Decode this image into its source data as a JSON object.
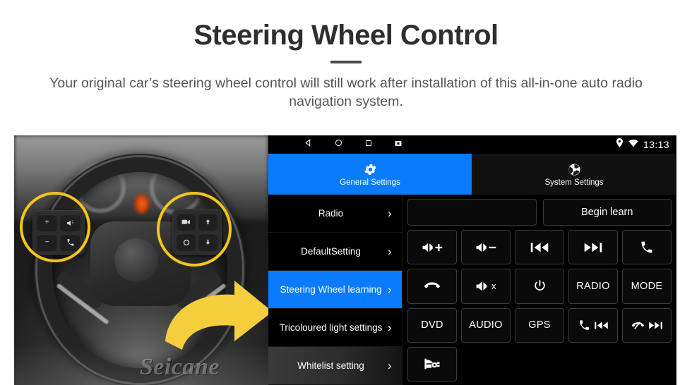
{
  "header": {
    "title": "Steering Wheel Control",
    "subtitle": "Your original car’s steering wheel control will still work after installation of this all-in-one auto radio navigation system."
  },
  "colors": {
    "accent_blue": "#0b7bfd",
    "highlight_yellow": "#f5c518",
    "screen_black": "#000000",
    "title_gray": "#2e2e2e"
  },
  "photo": {
    "watermark": "Seicane",
    "left_pad_keys": [
      "volume-up",
      "voice-command",
      "volume-down",
      "call"
    ],
    "right_pad_keys": [
      "media-source",
      "up-arrow",
      "circle-mode",
      "down-arrow"
    ],
    "highlight_circles": 2,
    "arrow": "right-arrow"
  },
  "statusbar": {
    "icons": [
      "back-icon",
      "home-icon",
      "recents-icon",
      "screenshot-icon"
    ],
    "location_icon": "location-icon",
    "wifi_icon": "wifi-icon",
    "time": "13:13"
  },
  "tabs": [
    {
      "label": "General Settings",
      "icon": "gear-icon",
      "active": true
    },
    {
      "label": "System Settings",
      "icon": "system-swirl-icon",
      "active": false
    }
  ],
  "menu": {
    "items": [
      {
        "label": "Radio",
        "state": "normal"
      },
      {
        "label": "DefaultSetting",
        "state": "normal"
      },
      {
        "label": "Steering Wheel learning",
        "state": "selected"
      },
      {
        "label": "Tricoloured light settings",
        "state": "normal"
      },
      {
        "label": "Whitelist setting",
        "state": "shaded"
      }
    ],
    "chevron": "›"
  },
  "panel": {
    "learn_input_value": "",
    "learn_input_placeholder": "",
    "begin_button": "Begin learn",
    "buttons": [
      {
        "id": "vol-up",
        "icon": "volume-up-icon",
        "label": ""
      },
      {
        "id": "vol-down",
        "icon": "volume-down-icon",
        "label": ""
      },
      {
        "id": "prev-track",
        "icon": "previous-track-icon",
        "label": ""
      },
      {
        "id": "next-track",
        "icon": "next-track-icon",
        "label": ""
      },
      {
        "id": "call",
        "icon": "phone-call-icon",
        "label": ""
      },
      {
        "id": "hangup",
        "icon": "phone-hangup-icon",
        "label": ""
      },
      {
        "id": "mute",
        "icon": "volume-mute-icon",
        "label": ""
      },
      {
        "id": "power",
        "icon": "power-icon",
        "label": ""
      },
      {
        "id": "radio",
        "icon": "",
        "label": "RADIO"
      },
      {
        "id": "mode",
        "icon": "",
        "label": "MODE"
      },
      {
        "id": "dvd",
        "icon": "",
        "label": "DVD"
      },
      {
        "id": "audio",
        "icon": "",
        "label": "AUDIO"
      },
      {
        "id": "gps",
        "icon": "",
        "label": "GPS"
      },
      {
        "id": "call-prev",
        "icon": "phone-previous-icon",
        "label": ""
      },
      {
        "id": "hangup-next",
        "icon": "hangup-next-icon",
        "label": ""
      },
      {
        "id": "navi-car",
        "icon": "car-navigation-icon",
        "label": ""
      }
    ]
  }
}
